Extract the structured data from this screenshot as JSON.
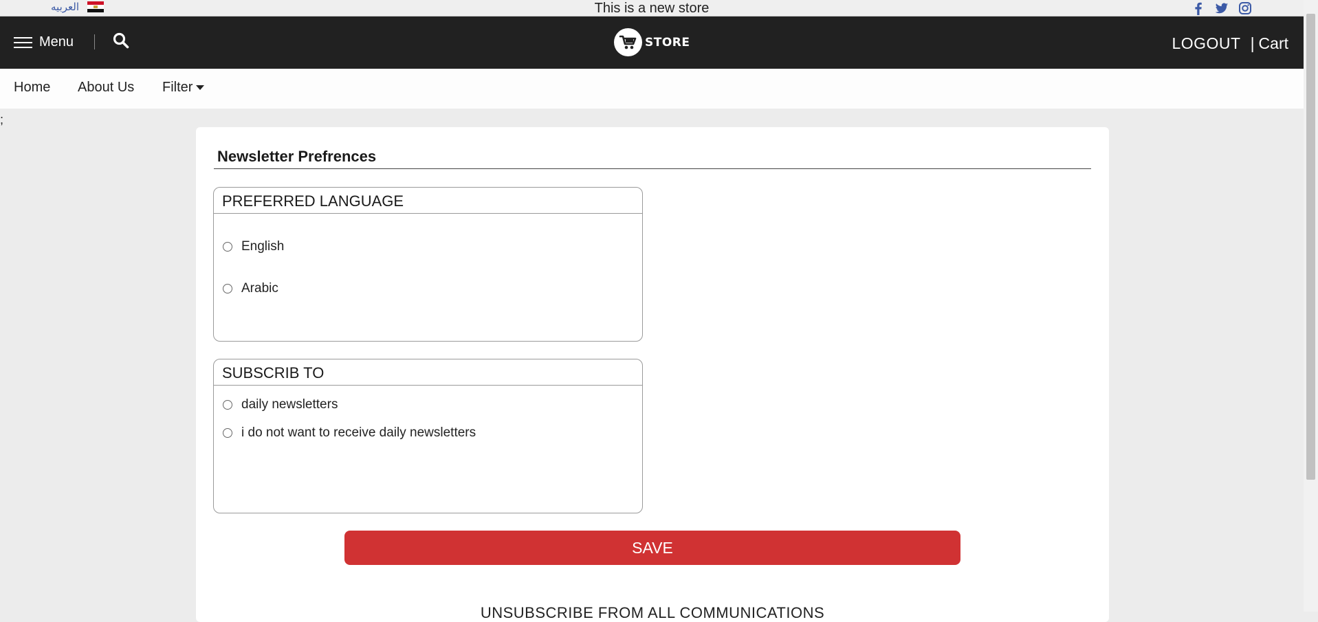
{
  "topbar": {
    "language_link": "العربيه",
    "announcement": "This is a new store",
    "socials": [
      "facebook-icon",
      "twitter-icon",
      "instagram-icon"
    ],
    "social_color": "#3c5aa6"
  },
  "header": {
    "menu_label": "Menu",
    "logo_text": "STORE",
    "logout_label": "LOGOUT",
    "separator": "|",
    "cart_label": "Cart",
    "background": "#212121"
  },
  "nav": {
    "items": [
      {
        "label": "Home"
      },
      {
        "label": "About Us"
      },
      {
        "label": "Filter"
      }
    ]
  },
  "stray_text": ";",
  "form": {
    "title": "Newsletter Prefrences",
    "language_group": {
      "legend": "PREFERRED LANGUAGE",
      "options": [
        "English",
        "Arabic"
      ]
    },
    "subscribe_group": {
      "legend": "SUBSCRIB TO",
      "options": [
        "daily newsletters",
        "i do not want to receive daily newsletters"
      ]
    },
    "save_label": "SAVE",
    "save_color": "#d03233",
    "unsubscribe_label": "UNSUBSCRIBE FROM ALL COMMUNICATIONS"
  }
}
